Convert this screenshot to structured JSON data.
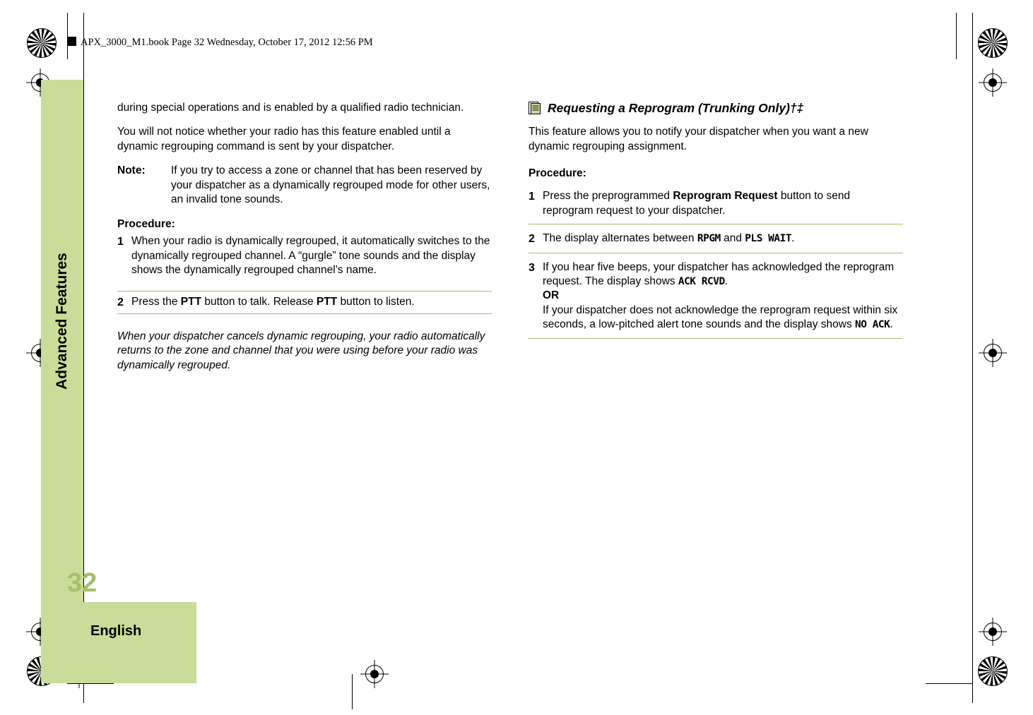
{
  "header": {
    "bookline": "APX_3000_M1.book  Page 32  Wednesday, October 17, 2012  12:56 PM"
  },
  "sidebar": {
    "chapter_label": "Advanced Features",
    "page_number": "32",
    "language": "English"
  },
  "left_column": {
    "para1": "during special operations and is enabled by a qualified radio technician.",
    "para2": "You will not notice whether your radio has this feature enabled until a dynamic regrouping command is sent by your dispatcher.",
    "note_label": "Note:",
    "note_text": "If you try to access a zone or channel that has been reserved by your dispatcher as a dynamically regrouped mode for other users, an invalid tone sounds.",
    "procedure_label": "Procedure:",
    "step1_num": "1",
    "step1_text": "When your radio is dynamically regrouped, it automatically switches to the dynamically regrouped channel. A “gurgle” tone sounds and the display shows the dynamically regrouped channel’s name.",
    "step2_num": "2",
    "step2_pre": "Press the ",
    "step2_b1": "PTT",
    "step2_mid": " button to talk. Release ",
    "step2_b2": "PTT",
    "step2_post": " button to listen.",
    "closing_italic": "When your dispatcher cancels dynamic regrouping, your radio automatically returns to the zone and channel that you were using before your radio was dynamically regrouped."
  },
  "right_column": {
    "section_icon": "book-icon",
    "section_title": "Requesting a Reprogram (Trunking Only)†‡",
    "para1": "This feature allows you to notify your dispatcher when you want a new dynamic regrouping assignment.",
    "procedure_label": "Procedure:",
    "step1_num": "1",
    "step1_pre": "Press the preprogrammed ",
    "step1_b": "Reprogram Request",
    "step1_post": " button to send reprogram request to your dispatcher.",
    "step2_num": "2",
    "step2_pre": "The display alternates between ",
    "step2_lcd1": "RPGM",
    "step2_mid": " and ",
    "step2_lcd2": "PLS WAIT",
    "step2_post": ".",
    "step3_num": "3",
    "step3_pre": "If you hear five beeps, your dispatcher has acknowledged the reprogram request. The display shows ",
    "step3_lcd1": "ACK RCVD",
    "step3_post": ".",
    "step3_or": "OR",
    "step3_alt_pre": "If your dispatcher does not acknowledge the reprogram request within six seconds, a low-pitched alert tone sounds and the display shows ",
    "step3_lcd2": "NO ACK",
    "step3_alt_post": "."
  },
  "colors": {
    "accent_green": "#c9dc9a",
    "rule_green": "#a5bf6a",
    "page_number_green": "#a5bf6a"
  }
}
